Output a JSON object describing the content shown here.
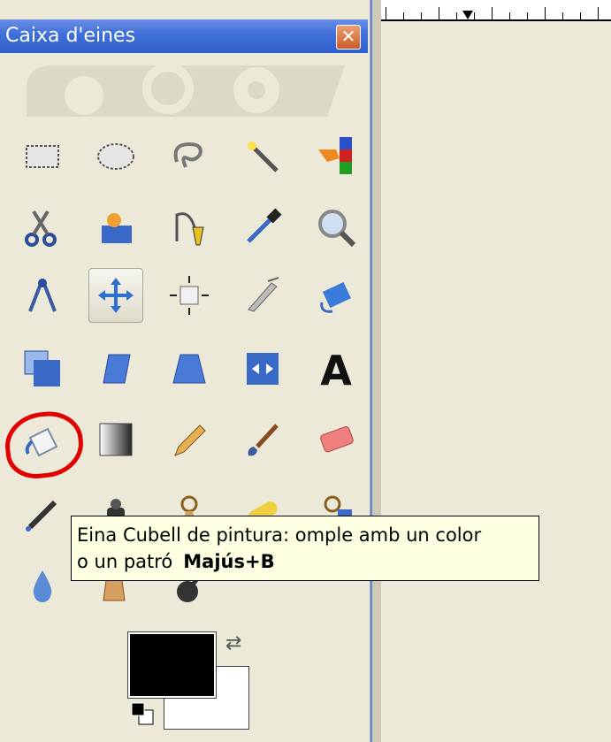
{
  "window": {
    "title": "Caixa d'eines",
    "close_glyph": "✕"
  },
  "tools": [
    {
      "name": "rect-select-icon"
    },
    {
      "name": "ellipse-select-icon"
    },
    {
      "name": "free-select-icon"
    },
    {
      "name": "fuzzy-select-icon"
    },
    {
      "name": "color-select-icon"
    },
    {
      "name": "scissors-select-icon"
    },
    {
      "name": "foreground-select-icon"
    },
    {
      "name": "paths-icon"
    },
    {
      "name": "color-picker-icon"
    },
    {
      "name": "zoom-icon"
    },
    {
      "name": "measure-icon"
    },
    {
      "name": "move-icon",
      "active": true
    },
    {
      "name": "align-icon"
    },
    {
      "name": "crop-icon"
    },
    {
      "name": "rotate-icon"
    },
    {
      "name": "scale-icon"
    },
    {
      "name": "shear-icon"
    },
    {
      "name": "perspective-icon"
    },
    {
      "name": "flip-icon"
    },
    {
      "name": "text-icon"
    },
    {
      "name": "bucket-fill-icon"
    },
    {
      "name": "blend-icon"
    },
    {
      "name": "pencil-icon"
    },
    {
      "name": "paintbrush-icon"
    },
    {
      "name": "eraser-icon"
    },
    {
      "name": "airbrush-icon"
    },
    {
      "name": "ink-icon"
    },
    {
      "name": "clone-icon"
    },
    {
      "name": "heal-icon"
    },
    {
      "name": "perspective-clone-icon"
    },
    {
      "name": "blur-icon"
    },
    {
      "name": "smudge-icon"
    },
    {
      "name": "dodge-burn-icon"
    }
  ],
  "tooltip": {
    "line1": "Eina Cubell de pintura: omple amb un color",
    "line2": "o un patró",
    "shortcut": "Majús+B"
  },
  "colors": {
    "foreground": "#000000",
    "background": "#ffffff"
  },
  "accent": {
    "title_bar": "#3f6fd9",
    "highlight": "#e00000"
  }
}
